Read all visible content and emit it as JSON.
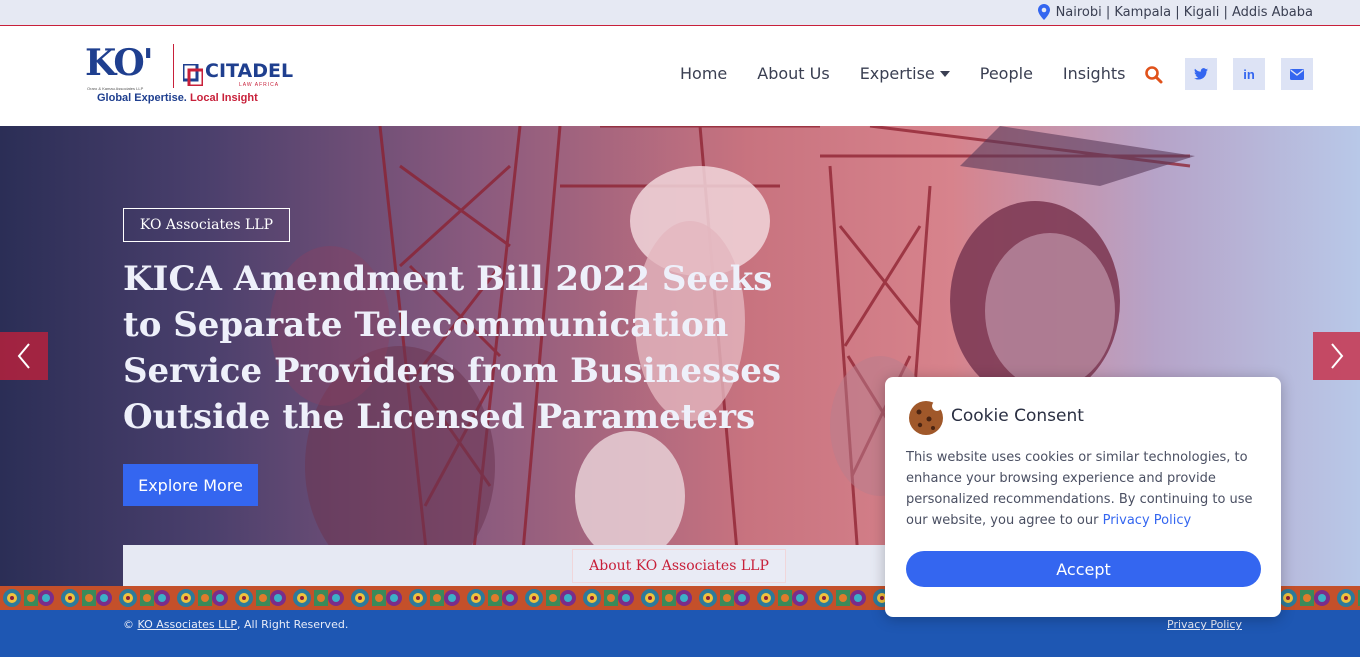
{
  "topbar": {
    "locations": "Nairobi | Kampala | Kigali | Addis Ababa",
    "location_icon": "map-pin-icon"
  },
  "logo": {
    "ko": "KO'",
    "ko_subtext": "Oraro & Kamau Associates LLP",
    "citadel": "CITADEL",
    "citadel_sub": "LAW AFRICA",
    "tagline_a": "Global Expertise.",
    "tagline_b": "Local Insight"
  },
  "nav": {
    "items": [
      "Home",
      "About Us",
      "Expertise",
      "People",
      "Insights"
    ],
    "search_icon": "search-icon",
    "social_icons": [
      "twitter-icon",
      "linkedin-icon",
      "mail-icon"
    ],
    "social_glyphs": [
      "t",
      "in",
      "✉"
    ]
  },
  "hero": {
    "badge": "KO Associates LLP",
    "headline": "KICA Amendment Bill 2022 Seeks to Separate Telecommunication Service Providers from Businesses Outside the Licensed Parameters",
    "cta": "Explore More",
    "about_link": "About KO Associates LLP",
    "prev_icon": "chevron-left-icon",
    "next_icon": "chevron-right-icon"
  },
  "footer": {
    "copy_prefix": "© ",
    "copy_link": "KO Associates LLP",
    "copy_suffix": ", All Right Reserved.",
    "privacy": "Privacy Policy"
  },
  "cookie": {
    "title": "Cookie Consent",
    "body": "This website uses cookies or similar technologies, to enhance your browsing experience and provide personalized recommendations. By continuing to use our website, you agree to our ",
    "privacy_link": "Privacy Policy",
    "accept": "Accept",
    "icon": "cookie-icon"
  },
  "colors": {
    "brand_blue": "#3466f0",
    "brand_red": "#c8203a",
    "footer_blue": "#1e57b3"
  }
}
